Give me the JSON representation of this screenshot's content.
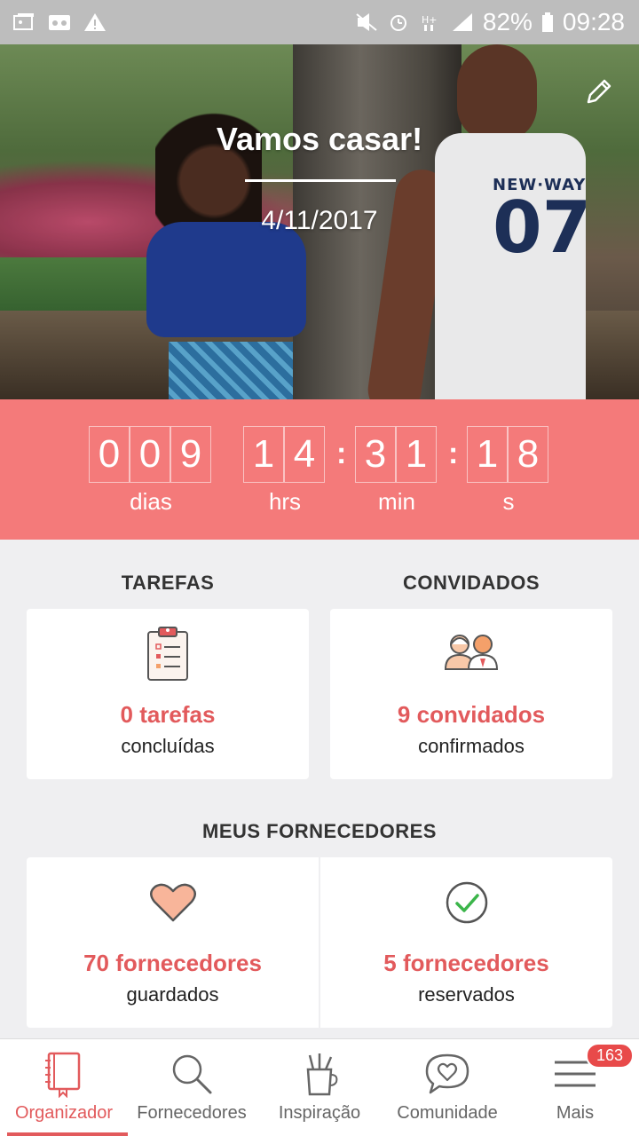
{
  "status_bar": {
    "battery": "82%",
    "time": "09:28",
    "icons": [
      "gallery-icon",
      "voicemail-icon",
      "warning-icon",
      "mute-icon",
      "alarm-icon",
      "hplus-icon",
      "signal-icon",
      "battery-icon"
    ]
  },
  "hero": {
    "title": "Vamos casar!",
    "date": "4/11/2017",
    "jersey_brand": "NEW·WAY",
    "jersey_number": "07",
    "edit_icon": "pencil-icon"
  },
  "countdown": {
    "days": [
      "0",
      "0",
      "9"
    ],
    "hours": [
      "1",
      "4"
    ],
    "minutes": [
      "3",
      "1"
    ],
    "seconds": [
      "1",
      "8"
    ],
    "separator": ":",
    "labels": {
      "days": "dias",
      "hours": "hrs",
      "minutes": "min",
      "seconds": "s"
    }
  },
  "tasks": {
    "title": "TAREFAS",
    "value": "0 tarefas",
    "sub": "concluídas",
    "icon": "clipboard-icon"
  },
  "guests": {
    "title": "CONVIDADOS",
    "value": "9 convidados",
    "sub": "confirmados",
    "icon": "guests-icon"
  },
  "vendors": {
    "title": "MEUS FORNECEDORES",
    "saved": {
      "value": "70 fornecedores",
      "sub": "guardados",
      "icon": "heart-icon"
    },
    "booked": {
      "value": "5 fornecedores",
      "sub": "reservados",
      "icon": "check-circle-icon"
    }
  },
  "nav": {
    "items": [
      {
        "label": "Organizador",
        "icon": "notebook-icon",
        "active": true
      },
      {
        "label": "Fornecedores",
        "icon": "search-icon",
        "active": false
      },
      {
        "label": "Inspiração",
        "icon": "pencil-cup-icon",
        "active": false
      },
      {
        "label": "Comunidade",
        "icon": "chat-heart-icon",
        "active": false
      },
      {
        "label": "Mais",
        "icon": "menu-icon",
        "active": false,
        "badge": "163"
      }
    ]
  },
  "colors": {
    "accent": "#f47a7a",
    "accent_text": "#e25a5c",
    "background": "#efeff1",
    "status_bar": "#bdbdbd"
  }
}
